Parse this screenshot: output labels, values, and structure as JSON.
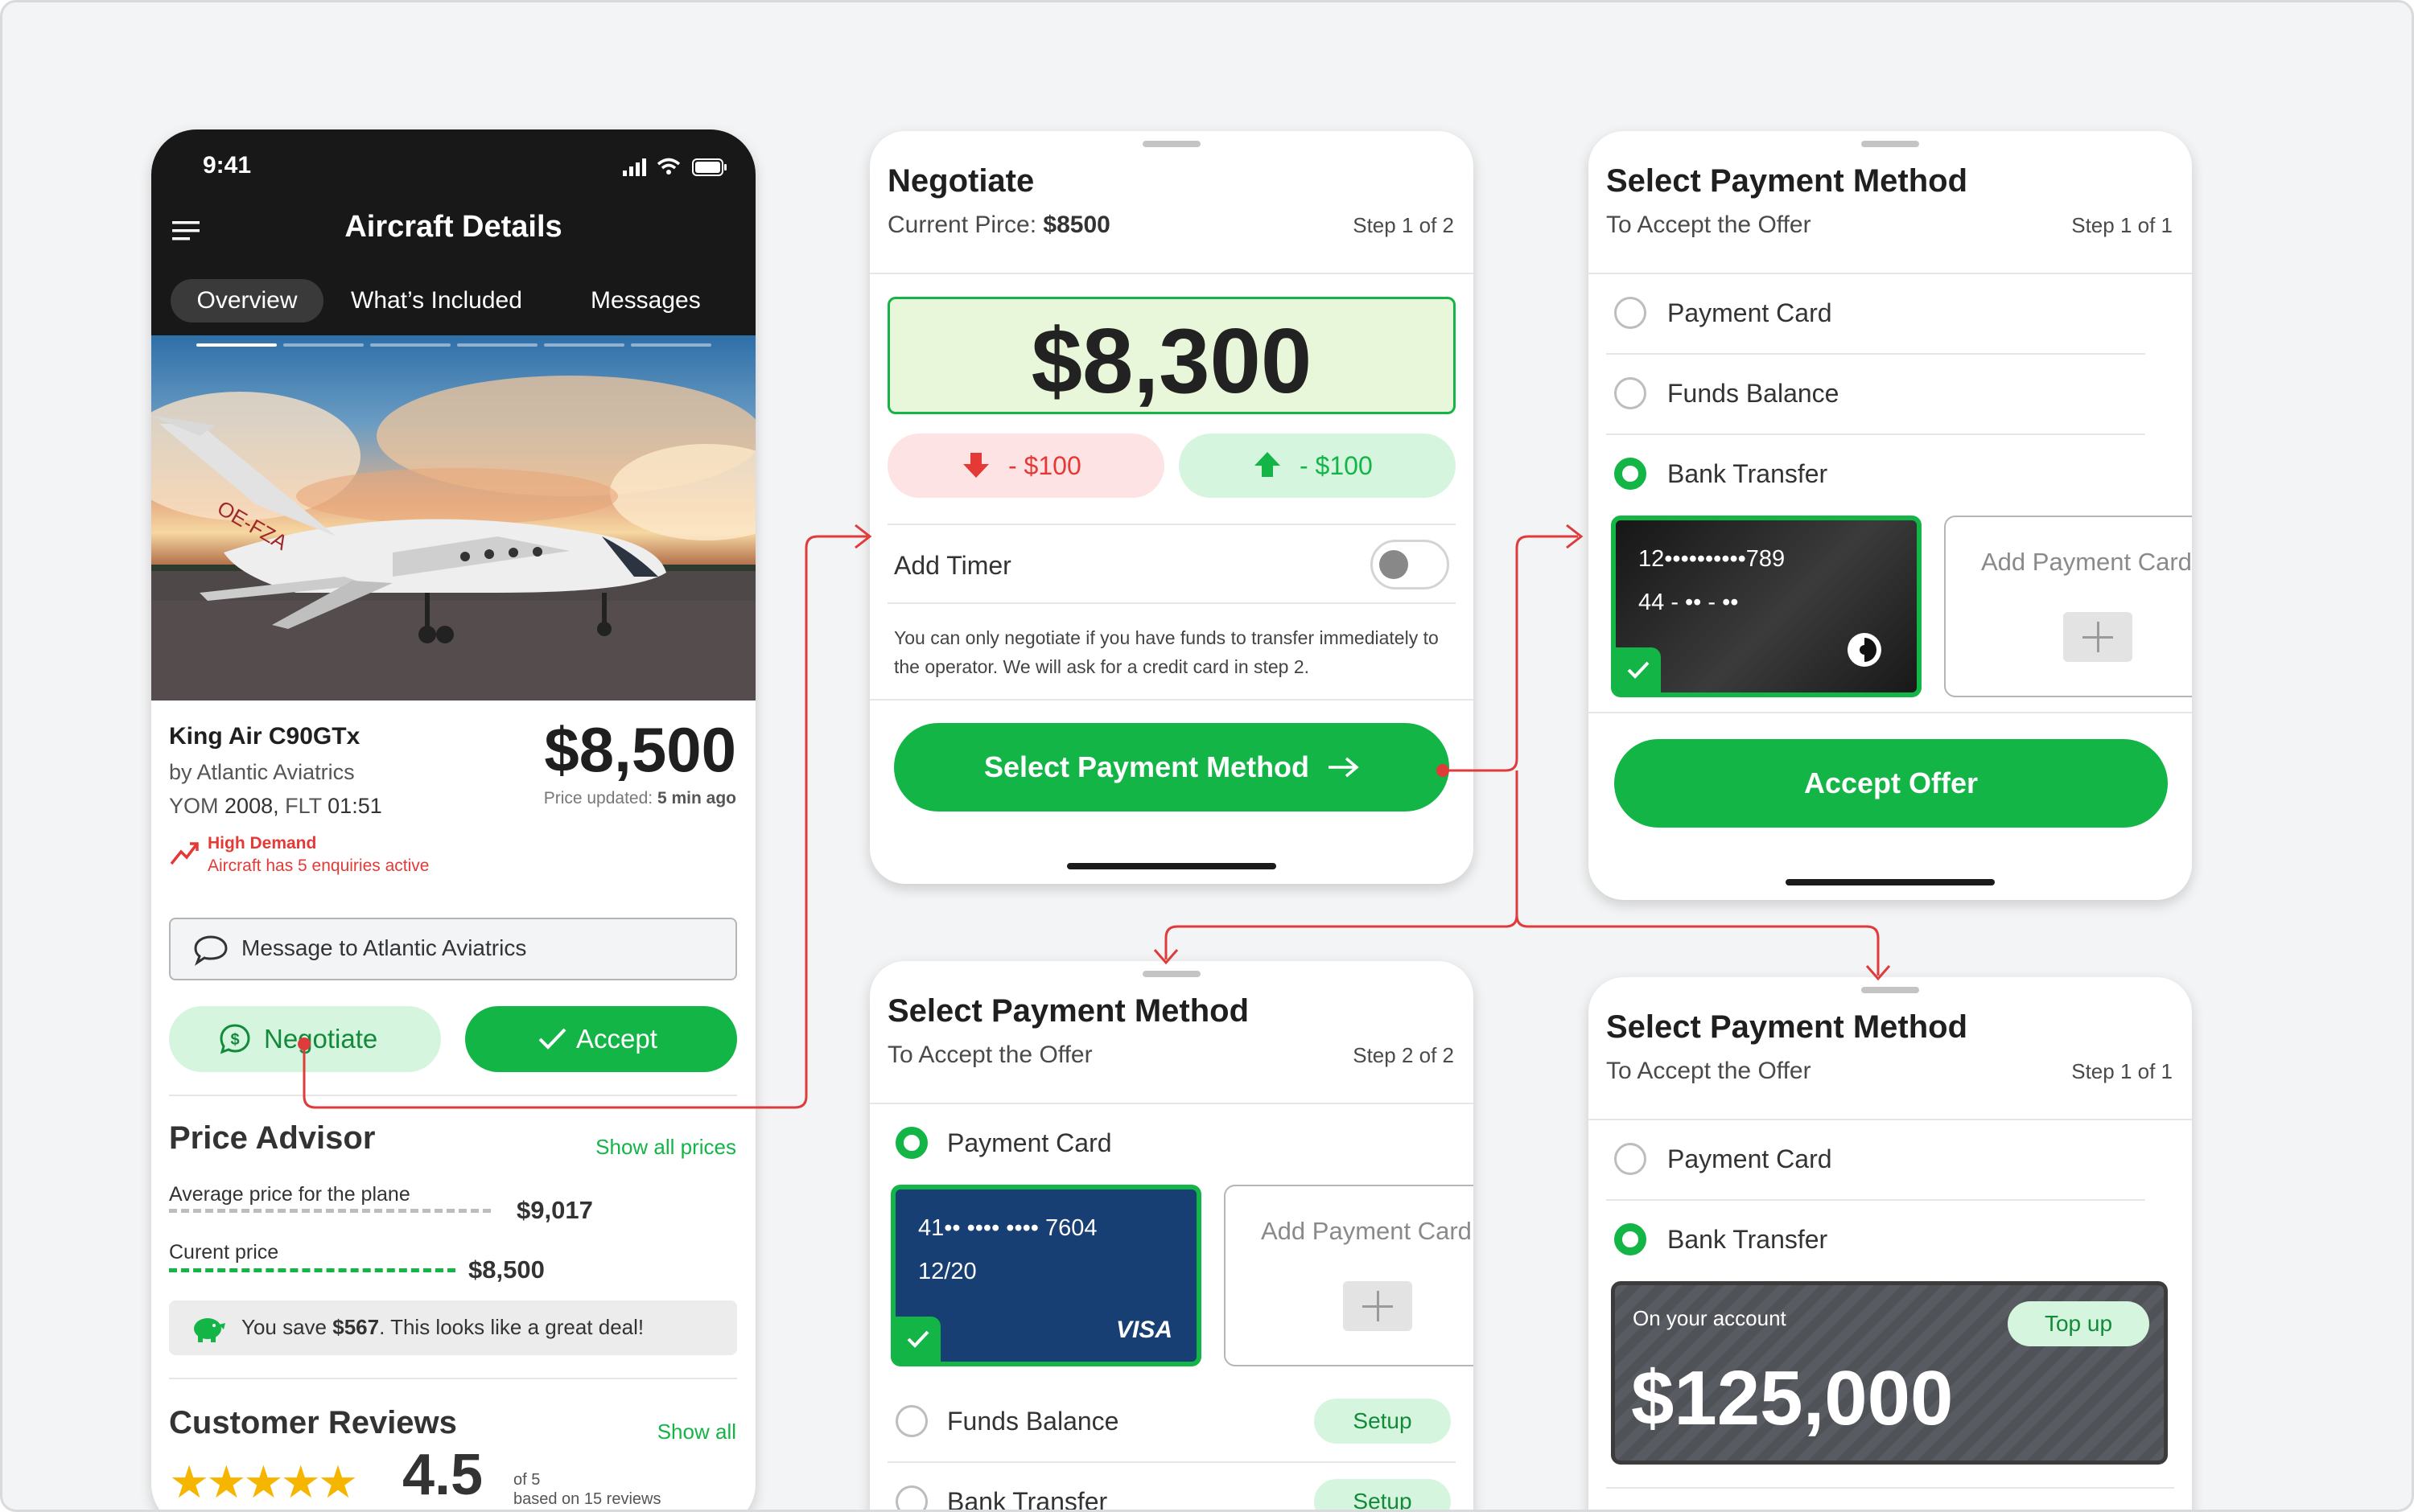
{
  "phone": {
    "time": "9:41",
    "title": "Aircraft Details",
    "tabs": [
      "Overview",
      "What’s Included",
      "Messages"
    ],
    "aircraft_name": "King Air C90GTx",
    "operator": "by Atlantic Aviatrics",
    "yom_label": "YOM",
    "yom": "2008,",
    "flt_label": "FLT",
    "flt": "01:51",
    "price": "$8,500",
    "price_updated_label": "Price updated:",
    "price_updated_value": "5 min ago",
    "demand_title": "High Demand",
    "demand_sub": "Aircraft has 5 enquiries active",
    "message_label": "Message to Atlantic Aviatrics",
    "negotiate_label": "Negotiate",
    "accept_label": "Accept",
    "advisor_title": "Price Advisor",
    "advisor_link": "Show all prices",
    "avg_label": "Average price for the plane",
    "avg_value": "$9,017",
    "current_label": "Curent price",
    "current_value": "$8,500",
    "save_prefix": "You save",
    "save_amount": "$567",
    "save_suffix": ". This looks like a great deal!",
    "reviews_title": "Customer Reviews",
    "reviews_link": "Show all",
    "rating": "4.5",
    "rating_of": "of 5",
    "rating_based": "based on 15 reviews",
    "tail_number": "OE-FZA",
    "colors": {
      "accent": "#13b547",
      "demand": "#e53935"
    }
  },
  "negotiate": {
    "title": "Negotiate",
    "current_label": "Current Pirce:",
    "current_value": "$8500",
    "step": "Step 1 of 2",
    "offer": "$8,300",
    "minus_label": "- $100",
    "plus_label": "- $100",
    "timer_label": "Add Timer",
    "note": "You can only negotiate if you have funds to transfer immediately to the operator. We will ask for a credit card in step 2.",
    "button": "Select Payment Method"
  },
  "pay_bank": {
    "title": "Select Payment Method",
    "subtitle": "To Accept the Offer",
    "step": "Step 1 of 1",
    "options": [
      "Payment Card",
      "Funds Balance",
      "Bank Transfer"
    ],
    "card_number": "12••••••••••789",
    "card_expiry": "44 - •• - ••",
    "add_card": "Add Payment Card",
    "button": "Accept Offer"
  },
  "pay_card": {
    "title": "Select Payment Method",
    "subtitle": "To Accept the Offer",
    "step": "Step 2 of 2",
    "option_card": "Payment Card",
    "card_number": "41•• •••• •••• 7604",
    "card_expiry": "12/20",
    "card_brand": "VISA",
    "add_card": "Add Payment Card",
    "option_funds": "Funds Balance",
    "option_bank": "Bank Transfer",
    "setup_label": "Setup"
  },
  "pay_funds": {
    "title": "Select Payment Method",
    "subtitle": "To Accept the Offer",
    "step": "Step 1 of 1",
    "options": [
      "Payment Card",
      "Bank Transfer"
    ],
    "account_label": "On your account",
    "topup_label": "Top up",
    "balance": "$125,000"
  }
}
